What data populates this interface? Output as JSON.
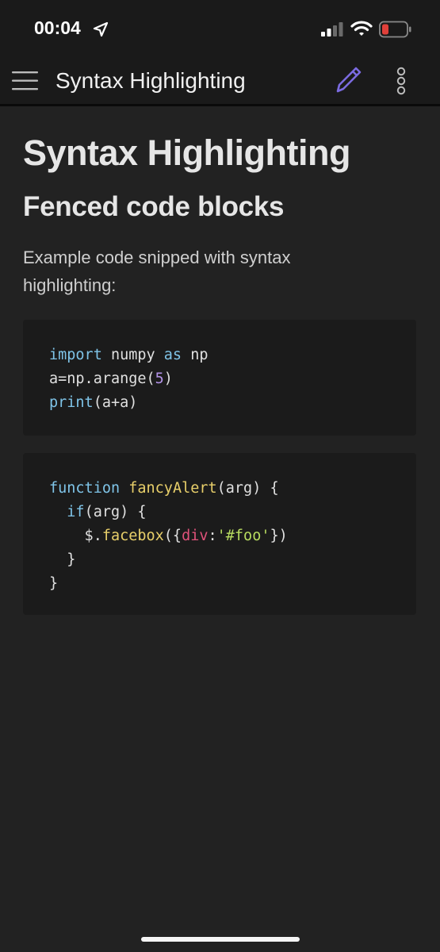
{
  "status_bar": {
    "time": "00:04",
    "location_icon": "location-arrow-icon",
    "signal_icon": "cellular-signal-icon",
    "wifi_icon": "wifi-icon",
    "battery_icon": "battery-low-icon",
    "battery_color": "#e0403a"
  },
  "app_bar": {
    "title": "Syntax Highlighting",
    "menu_icon": "hamburger-menu-icon",
    "edit_icon": "pencil-icon",
    "more_icon": "more-vertical-icon",
    "accent_color": "#7b6be0"
  },
  "document": {
    "heading1": "Syntax Highlighting",
    "heading2": "Fenced code blocks",
    "paragraph": "Example code snipped with syntax highlighting:",
    "code_block_1": {
      "line1": {
        "kw1": "import",
        "t1": " numpy ",
        "kw2": "as",
        "t2": " np"
      },
      "line2": {
        "t1": "a=np.arange(",
        "num": "5",
        "t2": ")"
      },
      "line3": {
        "kw": "print",
        "t1": "(a+a)"
      }
    },
    "code_block_2": {
      "line1": {
        "kw": "function",
        "sp": " ",
        "fn": "fancyAlert",
        "t1": "(arg) {"
      },
      "line2": {
        "indent": "  ",
        "kw": "if",
        "t1": "(arg) {"
      },
      "line3": {
        "indent": "    $.",
        "fn": "facebox",
        "t1": "({",
        "prop": "div",
        "t2": ":",
        "str": "'#foo'",
        "t3": "})"
      },
      "line4": {
        "t1": "  }"
      },
      "line5": {
        "t1": "}"
      }
    },
    "syntax_colors": {
      "keyword": "#7fc4e8",
      "number": "#b494e8",
      "function": "#e8cf6a",
      "property": "#e0527a",
      "string": "#b8dc60"
    }
  }
}
